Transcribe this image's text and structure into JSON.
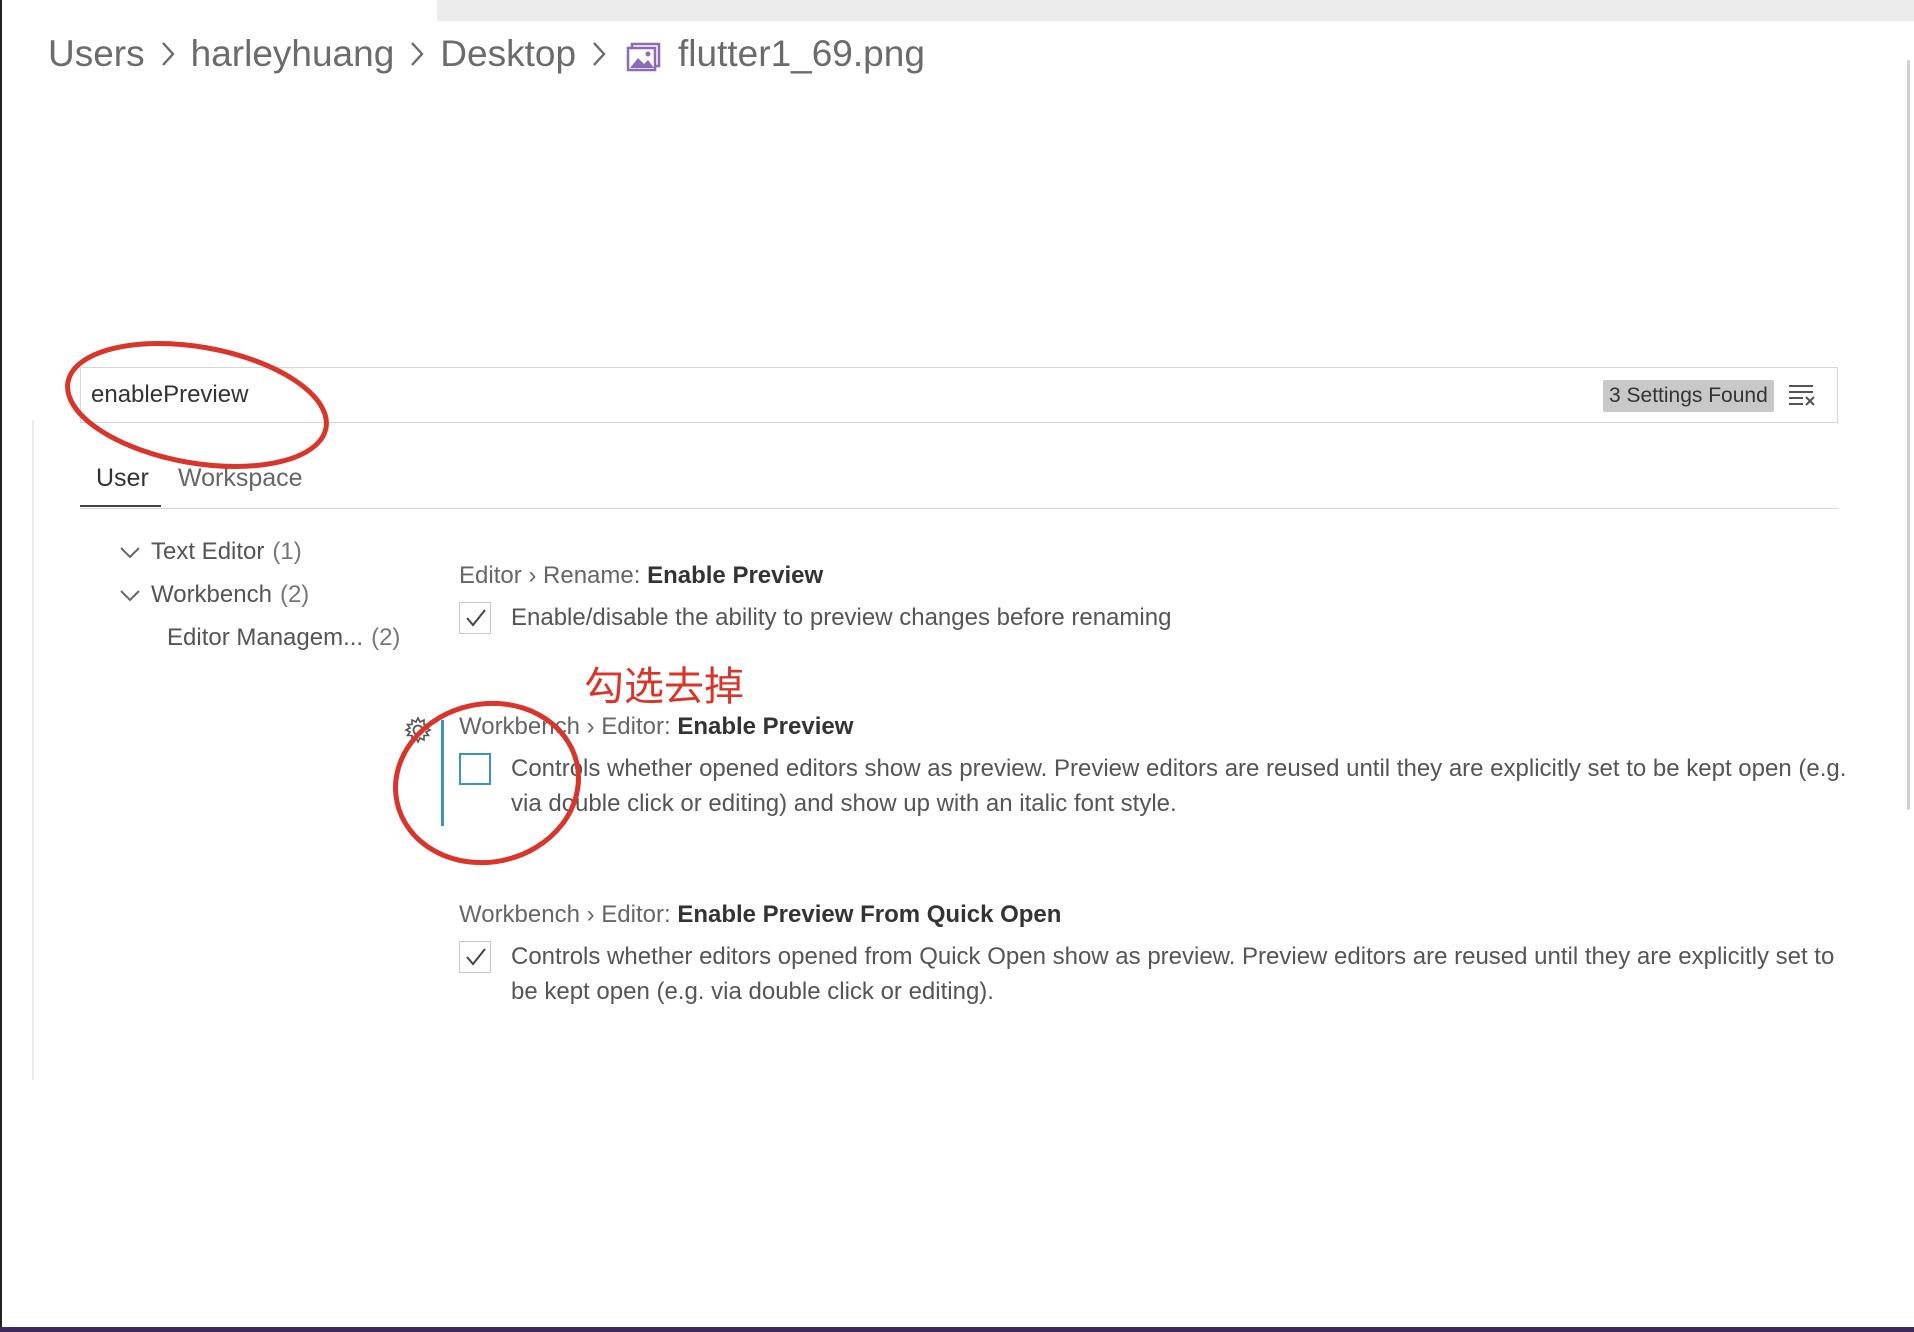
{
  "breadcrumb": {
    "items": [
      "Users",
      "harleyhuang",
      "Desktop"
    ],
    "file_name": "flutter1_69.png",
    "file_icon": "image-file-icon"
  },
  "search": {
    "value": "enablePreview",
    "results_badge": "3 Settings Found",
    "clear_icon": "clear-filter-icon"
  },
  "tabs": [
    {
      "label": "User",
      "active": true
    },
    {
      "label": "Workspace",
      "active": false
    }
  ],
  "toc": [
    {
      "label": "Text Editor",
      "count": "(1)",
      "expanded": true
    },
    {
      "label": "Workbench",
      "count": "(2)",
      "expanded": true
    },
    {
      "label": "Editor Managem...",
      "count": "(2)"
    }
  ],
  "settings": [
    {
      "category": "Editor › Rename: ",
      "name": "Enable Preview",
      "checked": true,
      "description": "Enable/disable the ability to preview changes before renaming"
    },
    {
      "category": "Workbench › Editor: ",
      "name": "Enable Preview",
      "checked": false,
      "description": "Controls whether opened editors show as preview. Preview editors are reused until they are explicitly set to be kept open (e.g. via double click or editing) and show up with an italic font style."
    },
    {
      "category": "Workbench › Editor: ",
      "name": "Enable Preview From Quick Open",
      "checked": true,
      "description": "Controls whether editors opened from Quick Open show as preview. Preview editors are reused until they are explicitly set to be kept open (e.g. via double click or editing)."
    }
  ],
  "annotation": {
    "text": "勾选去掉",
    "color": "#d9352a"
  },
  "colors": {
    "accent": "#3b92c9",
    "annotation_red": "#d9352a"
  }
}
